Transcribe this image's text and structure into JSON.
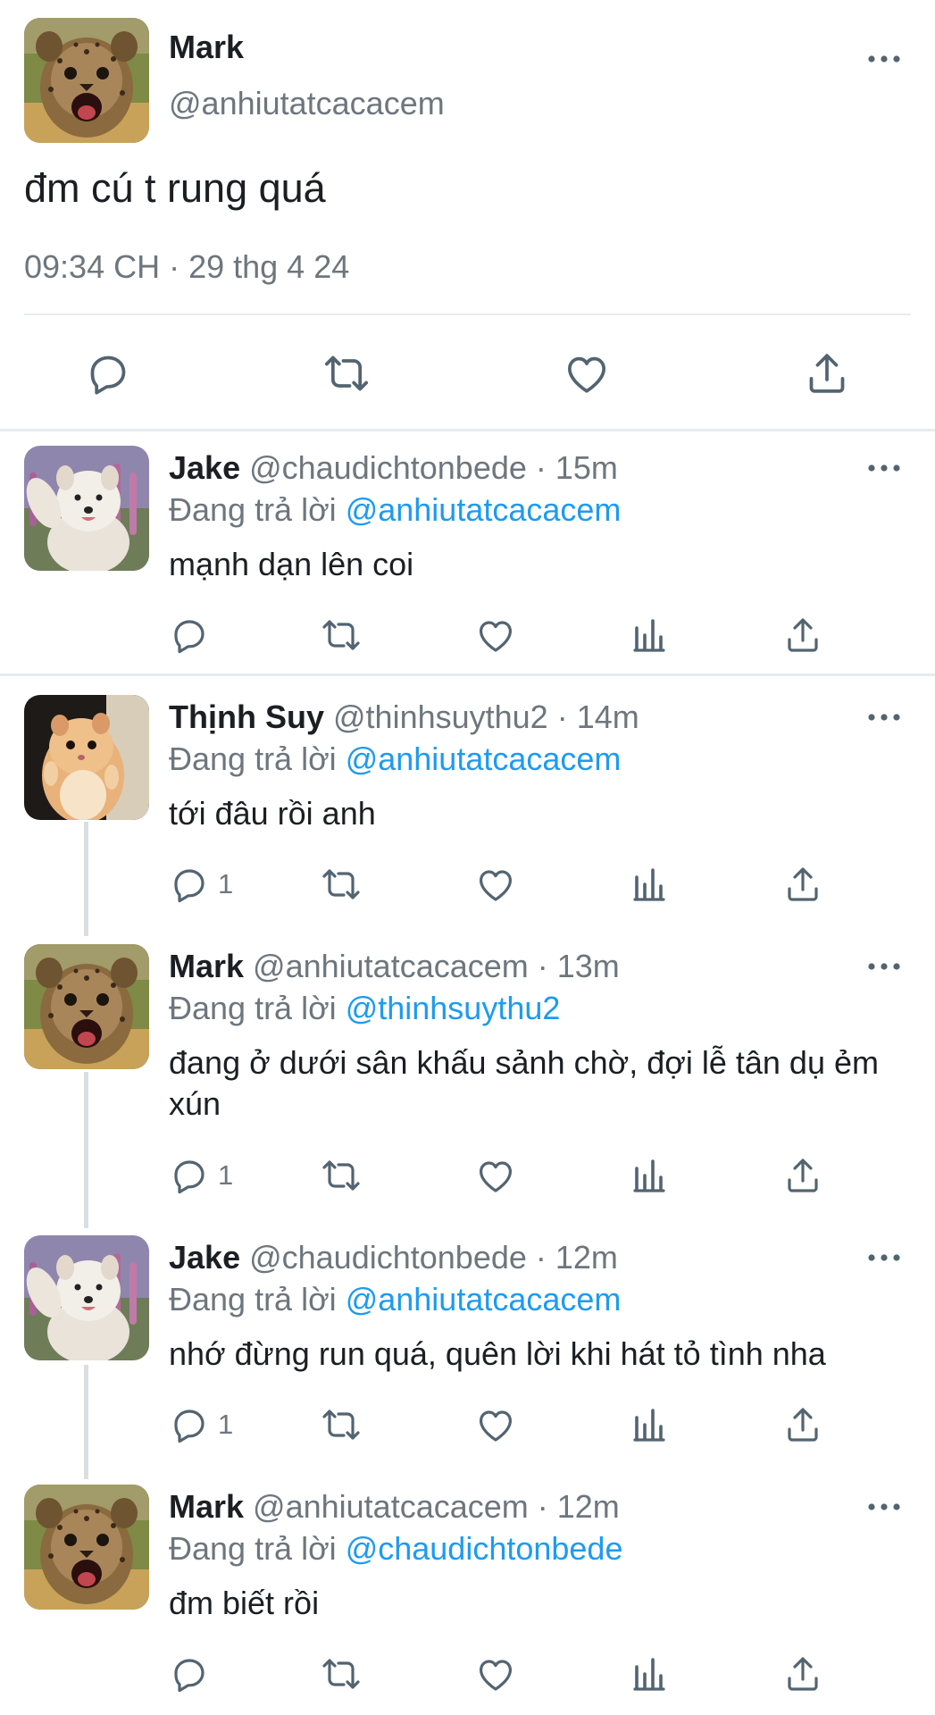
{
  "colors": {
    "link": "#1d9bf0",
    "secondary": "#6e767d",
    "divider": "#e6ecf0"
  },
  "main_tweet": {
    "name": "Mark",
    "handle": "@anhiutatcacacem",
    "text": "đm cú t rung quá",
    "meta": "09:34 CH · 29 thg 4 24",
    "more_icon": "ellipsis-icon",
    "actions": [
      "reply-icon",
      "retweet-icon",
      "like-icon",
      "share-icon"
    ]
  },
  "reply_prefix": "Đang trả lời ",
  "replies": [
    {
      "name": "Jake",
      "handle_time": " @chaudichtonbede · 15m",
      "reply_to": "@anhiutatcacacem",
      "text": "mạnh dạn lên coi",
      "reply_count": ""
    },
    {
      "name": "Thịnh Suy",
      "handle_time": " @thinhsuythu2 · 14m",
      "reply_to": "@anhiutatcacacem",
      "text": "tới đâu rồi anh",
      "reply_count": "1"
    },
    {
      "name": "Mark",
      "handle_time": " @anhiutatcacacem · 13m",
      "reply_to": "@thinhsuythu2",
      "text": "đang ở dưới sân khấu sảnh chờ, đợi lễ tân dụ ẻm xún",
      "reply_count": "1"
    },
    {
      "name": "Jake",
      "handle_time": " @chaudichtonbede · 12m",
      "reply_to": "@anhiutatcacacem",
      "text": "nhớ đừng run quá, quên lời khi hát tỏ tình nha",
      "reply_count": "1"
    },
    {
      "name": "Mark",
      "handle_time": " @anhiutatcacacem · 12m",
      "reply_to": "@chaudichtonbede",
      "text": "đm biết rồi",
      "reply_count": ""
    }
  ]
}
